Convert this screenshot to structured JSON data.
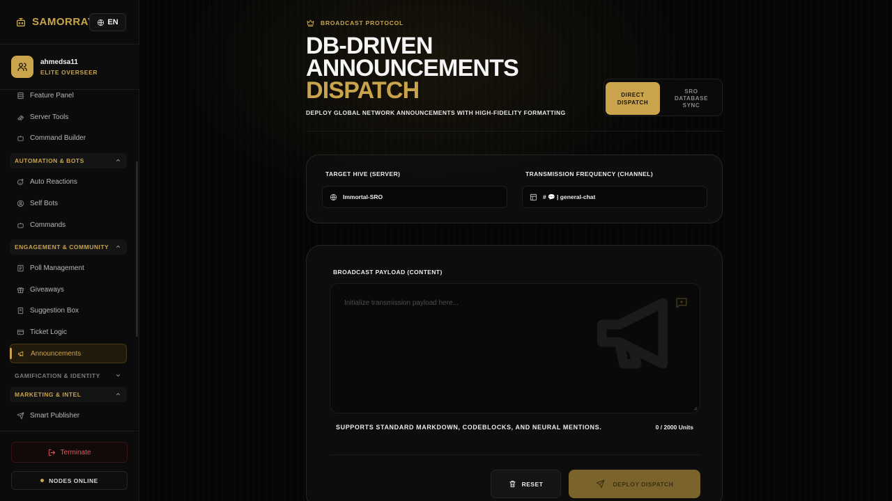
{
  "brand": {
    "name": "SAMORRAY"
  },
  "language": {
    "label": "EN"
  },
  "user": {
    "name": "ahmedsa11",
    "role": "ELITE OVERSEER"
  },
  "nav": {
    "items_top": [
      {
        "label": "Feature Panel",
        "icon": "panel-icon"
      },
      {
        "label": "Server Tools",
        "icon": "wrench-icon"
      },
      {
        "label": "Command Builder",
        "icon": "bot-icon"
      }
    ],
    "groups": [
      {
        "label": "AUTOMATION & BOTS",
        "expanded": true,
        "items": [
          {
            "label": "Auto Reactions",
            "icon": "reaction-icon"
          },
          {
            "label": "Self Bots",
            "icon": "self-bot-icon"
          },
          {
            "label": "Commands",
            "icon": "bot-icon"
          }
        ]
      },
      {
        "label": "ENGAGEMENT & COMMUNITY",
        "expanded": true,
        "items": [
          {
            "label": "Poll Management",
            "icon": "poll-icon"
          },
          {
            "label": "Giveaways",
            "icon": "gift-icon"
          },
          {
            "label": "Suggestion Box",
            "icon": "suggestion-icon"
          },
          {
            "label": "Ticket Logic",
            "icon": "ticket-icon"
          },
          {
            "label": "Announcements",
            "icon": "megaphone-icon",
            "active": true
          }
        ]
      },
      {
        "label": "GAMIFICATION & IDENTITY",
        "expanded": false,
        "items": []
      },
      {
        "label": "MARKETING & INTEL",
        "expanded": true,
        "items": [
          {
            "label": "Smart Publisher",
            "icon": "send-icon"
          }
        ]
      }
    ]
  },
  "footer": {
    "terminate_label": "Terminate",
    "nodes_label": "NODES ONLINE"
  },
  "header": {
    "eyebrow": "BROADCAST PROTOCOL",
    "title_line1": "DB-DRIVEN",
    "title_line2": "ANNOUNCEMENTS",
    "title_accent": "DISPATCH",
    "subtitle": "DEPLOY GLOBAL NETWORK ANNOUNCEMENTS WITH HIGH-FIDELITY FORMATTING"
  },
  "mode": {
    "option_a_line1": "DIRECT",
    "option_a_line2": "DISPATCH",
    "option_b_line1": "SRO",
    "option_b_line2": "DATABASE",
    "option_b_line3": "SYNC",
    "selected": "DIRECT DISPATCH"
  },
  "target": {
    "server_label": "TARGET HIVE (SERVER)",
    "server_value": "Immortal-SRO",
    "channel_label": "TRANSMISSION FREQUENCY (CHANNEL)",
    "channel_value": "# 💬 | general-chat"
  },
  "payload": {
    "label": "BROADCAST PAYLOAD (CONTENT)",
    "placeholder": "Initialize transmission payload here...",
    "value": "",
    "hint": "SUPPORTS STANDARD MARKDOWN, CODEBLOCKS, AND NEURAL MENTIONS.",
    "counter": "0 / 2000 Units"
  },
  "actions": {
    "reset_label": "RESET",
    "deploy_label": "DEPLOY DISPATCH"
  },
  "colors": {
    "accent": "#c9a44c",
    "danger": "#e05a5a",
    "background": "#050505"
  }
}
